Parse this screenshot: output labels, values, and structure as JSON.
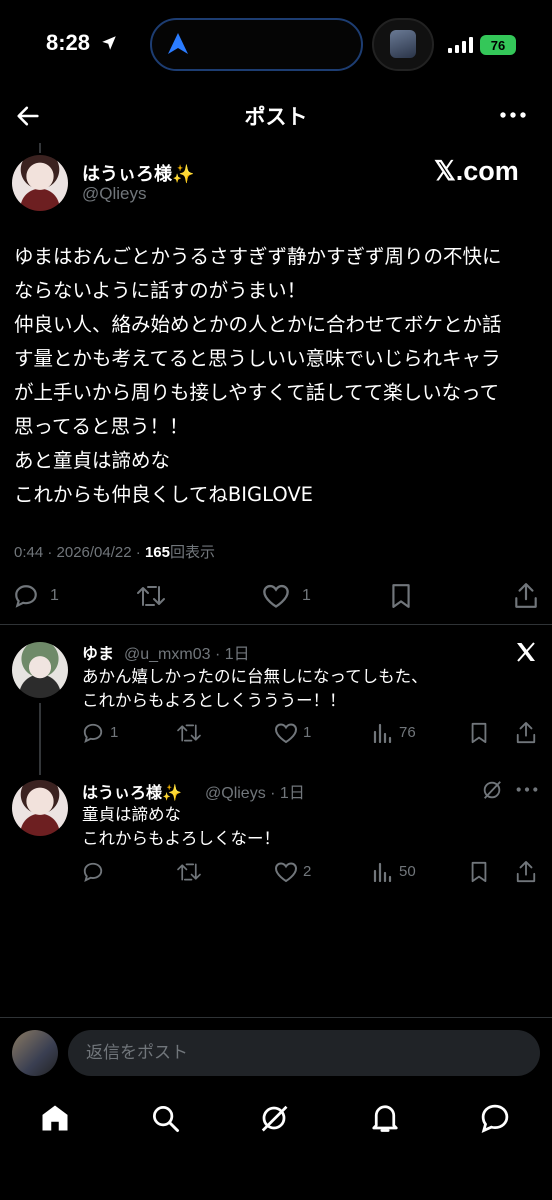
{
  "status_bar": {
    "time": "8:28",
    "battery": "76"
  },
  "header": {
    "title": "ポスト"
  },
  "post": {
    "author_name": "はうぃろ様✨",
    "author_handle": "@Qlieys",
    "watermark": "𝕏.com",
    "lines": [
      "ゆまはおんごとかうるさすぎず静かすぎず周りの不快に",
      "ならないように話すのがうまい！",
      "仲良い人、絡み始めとかの人とかに合わせてボケとか話",
      "す量とかも考えてると思うしいい意味でいじられキャラ",
      "が上手いから周りも接しやすくて話してて楽しいなって",
      "思ってると思う！！",
      "あと童貞は諦めな",
      "これからも仲良くしてねBIGLOVE"
    ],
    "timestamp": "0:44 · 2026/04/22 · ",
    "views": "165",
    "views_label": "回表示",
    "replies": "1",
    "likes": "1"
  },
  "replies": [
    {
      "name": "ゆま",
      "handle_time": "@u_mxm03 · 1日",
      "lines": [
        "あかん嬉しかったのに台無しになってしもた、",
        "これからもよろとしくうううー！！"
      ],
      "reply_count": "1",
      "like_count": "1",
      "view_count": "76"
    },
    {
      "name": "はうぃろ様✨",
      "handle_time": "@Qlieys · 1日",
      "lines": [
        "童貞は諦めな",
        "これからもよろしくなー！"
      ],
      "like_count": "2",
      "view_count": "50"
    }
  ],
  "compose": {
    "placeholder": "返信をポスト"
  },
  "icons": [
    "location-arrow-icon",
    "signal-icon",
    "back-arrow-icon",
    "more-icon",
    "reply-icon",
    "repost-icon",
    "like-icon",
    "bookmark-icon",
    "share-icon",
    "views-icon",
    "grok-icon",
    "x-logo-icon",
    "home-icon",
    "search-icon",
    "notifications-icon",
    "messages-icon"
  ]
}
